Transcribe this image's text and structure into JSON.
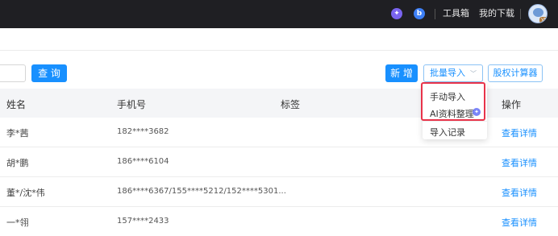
{
  "topbar": {
    "tools_label": "工具箱",
    "downloads_label": "我的下载",
    "avatar_badge": "V5"
  },
  "toolbar": {
    "search_input_value": "",
    "query_label": "查 询",
    "add_label": "新 增",
    "batch_import_label": "批量导入",
    "equity_calc_label": "股权计算器"
  },
  "table": {
    "headers": {
      "name": "姓名",
      "phone": "手机号",
      "tags": "标签",
      "action": "操作"
    },
    "rows": [
      {
        "name": "李*茜",
        "phone": "182****3682",
        "action": "查看详情"
      },
      {
        "name": "胡*鹏",
        "phone": "186****6104",
        "action": "查看详情"
      },
      {
        "name": "董*/沈*伟",
        "phone": "186****6367/155****5212/152****5301...",
        "action": "查看详情"
      },
      {
        "name": "一*翎",
        "phone": "157****2433",
        "action": "查看详情"
      }
    ]
  },
  "dropdown": {
    "items": [
      "手动导入",
      "AI资料整理",
      "导入记录"
    ]
  },
  "colors": {
    "primary": "#1890ff",
    "highlight": "#e8334a",
    "topbar": "#1f1f23"
  }
}
